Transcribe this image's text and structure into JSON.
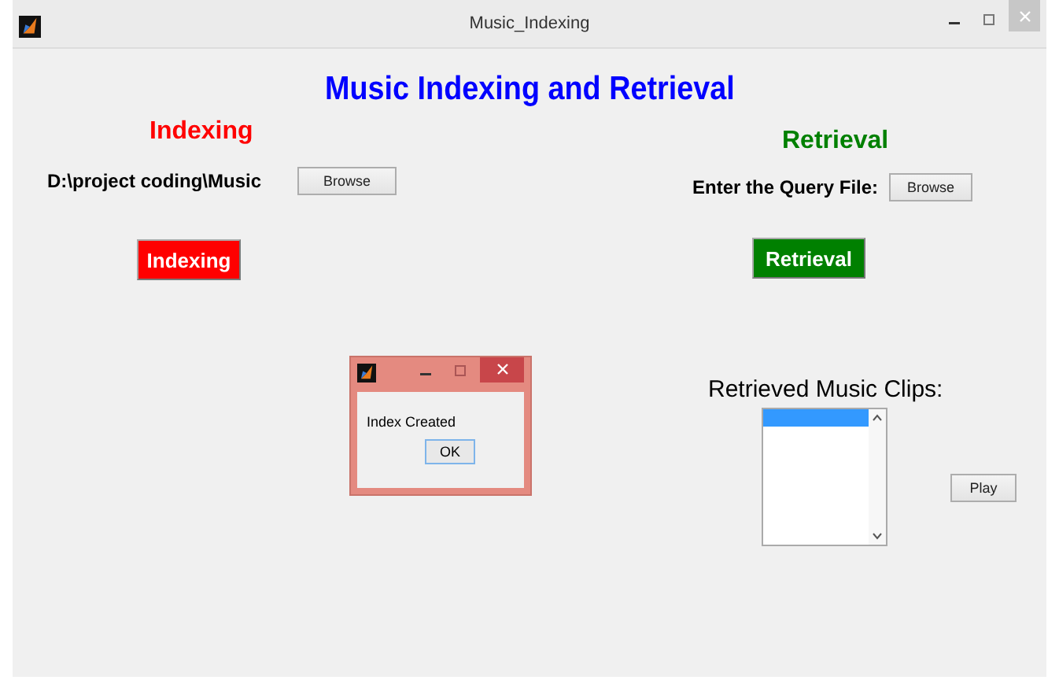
{
  "window": {
    "title": "Music_Indexing"
  },
  "heading": "Music Indexing and Retrieval",
  "indexing": {
    "title": "Indexing",
    "path": "D:\\project coding\\Music",
    "browse": "Browse",
    "button": "Indexing"
  },
  "retrieval": {
    "title": "Retrieval",
    "query_label": "Enter the Query File:",
    "browse": "Browse",
    "button": "Retrieval",
    "clips_label": "Retrieved Music Clips:",
    "clips": [
      {
        "selected": true
      }
    ],
    "play": "Play"
  },
  "dialog": {
    "message": "Index Created",
    "ok": "OK"
  }
}
